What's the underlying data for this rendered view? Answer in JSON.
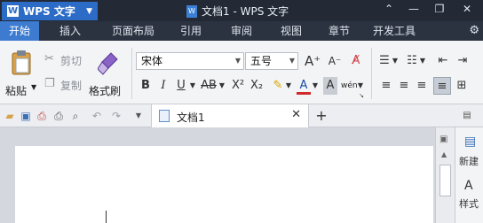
{
  "app": {
    "name": "WPS 文字",
    "doc_title": "文档1 - WPS 文字",
    "logo_letter": "W"
  },
  "window_controls": {
    "minimize": "⌃",
    "restore": "—",
    "maximize": "❐",
    "close": "✕"
  },
  "tabs": [
    {
      "label": "开始",
      "active": true
    },
    {
      "label": "插入"
    },
    {
      "label": "页面布局"
    },
    {
      "label": "引用"
    },
    {
      "label": "审阅"
    },
    {
      "label": "视图"
    },
    {
      "label": "章节"
    },
    {
      "label": "开发工具"
    }
  ],
  "ribbon": {
    "paste": "粘贴",
    "cut": "剪切",
    "copy": "复制",
    "format_painter": "格式刷",
    "font_name": "宋体",
    "font_size": "五号",
    "bold": "B",
    "italic": "I",
    "underline": "U",
    "strikethrough": "AB",
    "superscript": "X²",
    "subscript": "X₂",
    "font_color": "A",
    "char_shading": "A",
    "phonetic": "wén",
    "grow_font": "A⁺",
    "shrink_font": "A⁻"
  },
  "doc_tab": {
    "label": "文档1",
    "close": "✕",
    "add": "+"
  },
  "side_panel": {
    "new": "新建",
    "styles": "样式"
  },
  "colors": {
    "title_bg": "#232a36",
    "tab_bg": "#2b3341",
    "accent": "#3d7bd0",
    "app_btn": "#2d6cc6"
  }
}
